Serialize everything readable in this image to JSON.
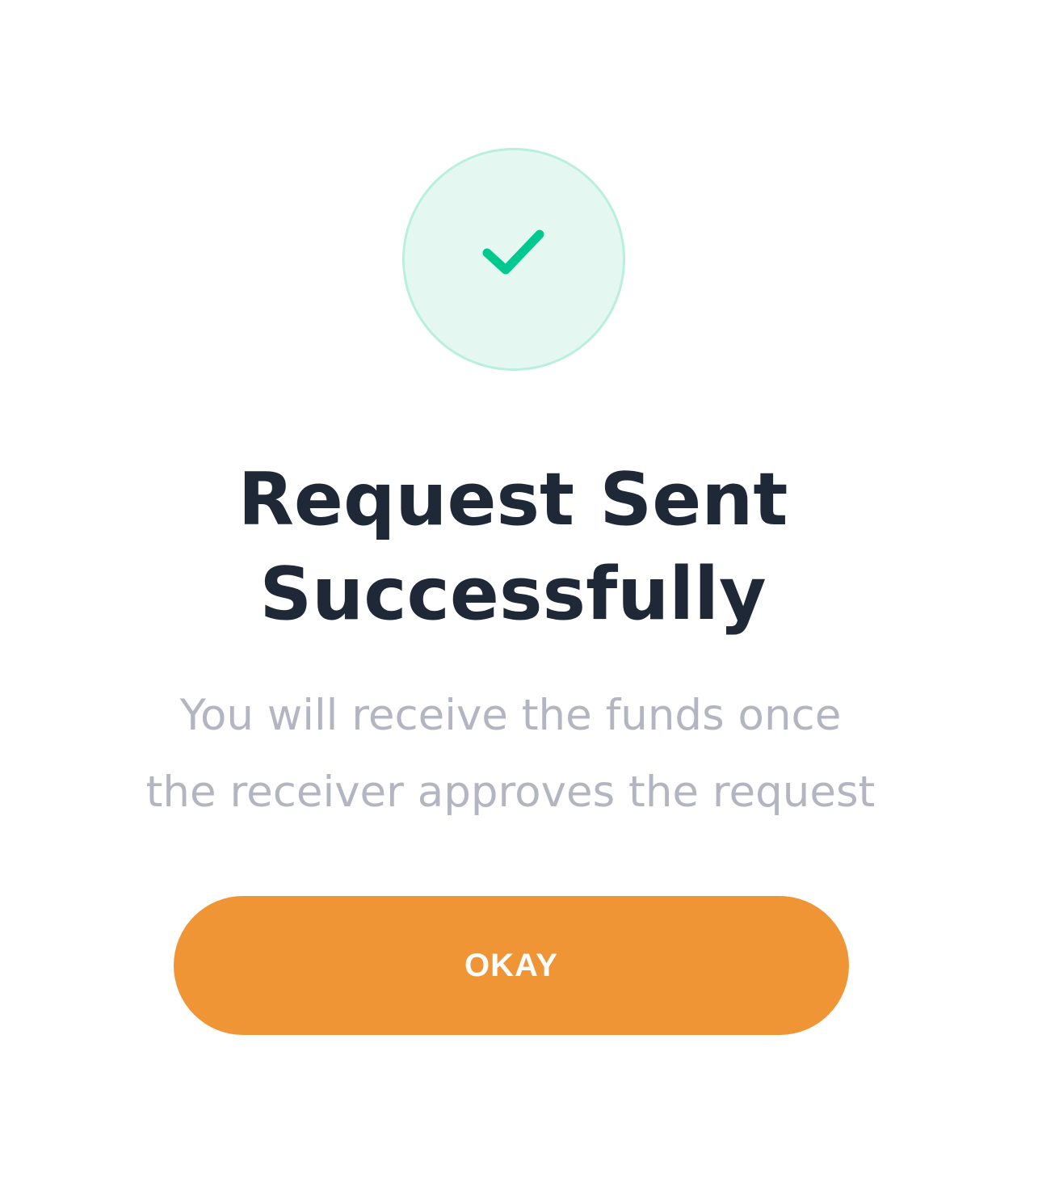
{
  "status": {
    "icon": "check-icon",
    "icon_color": "#00c98f",
    "circle_fill": "#e4f8f1",
    "circle_border": "#b9f0dc"
  },
  "title": {
    "line1": "Request Sent",
    "line2": "Successfully"
  },
  "message": {
    "line1": "You will receive the funds once",
    "line2": "the receiver approves the request"
  },
  "actions": {
    "okay_label": "OKAY",
    "okay_color": "#f09535"
  }
}
